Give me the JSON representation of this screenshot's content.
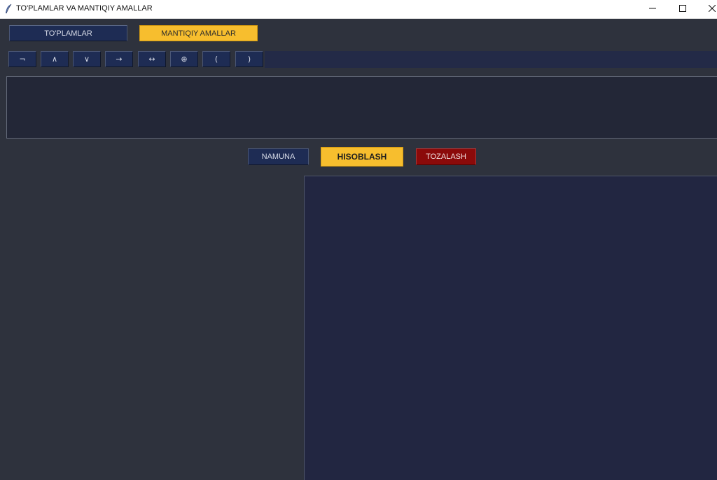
{
  "window": {
    "title": "TO'PLAMLAR VA MANTIQIY AMALLAR",
    "app_icon": "feather-icon",
    "controls": {
      "minimize_icon": "minimize-icon",
      "maximize_icon": "maximize-icon",
      "close_icon": "close-icon"
    }
  },
  "nav": {
    "sets_label": "TO'PLAMLAR",
    "logic_label": "MANTIQIY AMALLAR",
    "active": "MANTIQIY AMALLAR"
  },
  "operators": [
    {
      "symbol": "¬"
    },
    {
      "symbol": "∧"
    },
    {
      "symbol": "∨"
    },
    {
      "symbol": "→"
    },
    {
      "symbol": "↔"
    },
    {
      "symbol": "⊕"
    },
    {
      "symbol": "("
    },
    {
      "symbol": ")"
    }
  ],
  "expression": {
    "value": ""
  },
  "actions": {
    "sample_label": "NAMUNA",
    "calculate_label": "HISOBLASH",
    "clear_label": "TOZALASH"
  },
  "result": {
    "value": ""
  },
  "colors": {
    "background": "#2e323d",
    "button_navy": "#1e2c54",
    "accent_yellow": "#f7be2e",
    "danger_red": "#8b0a0a",
    "panel": "#232737"
  }
}
